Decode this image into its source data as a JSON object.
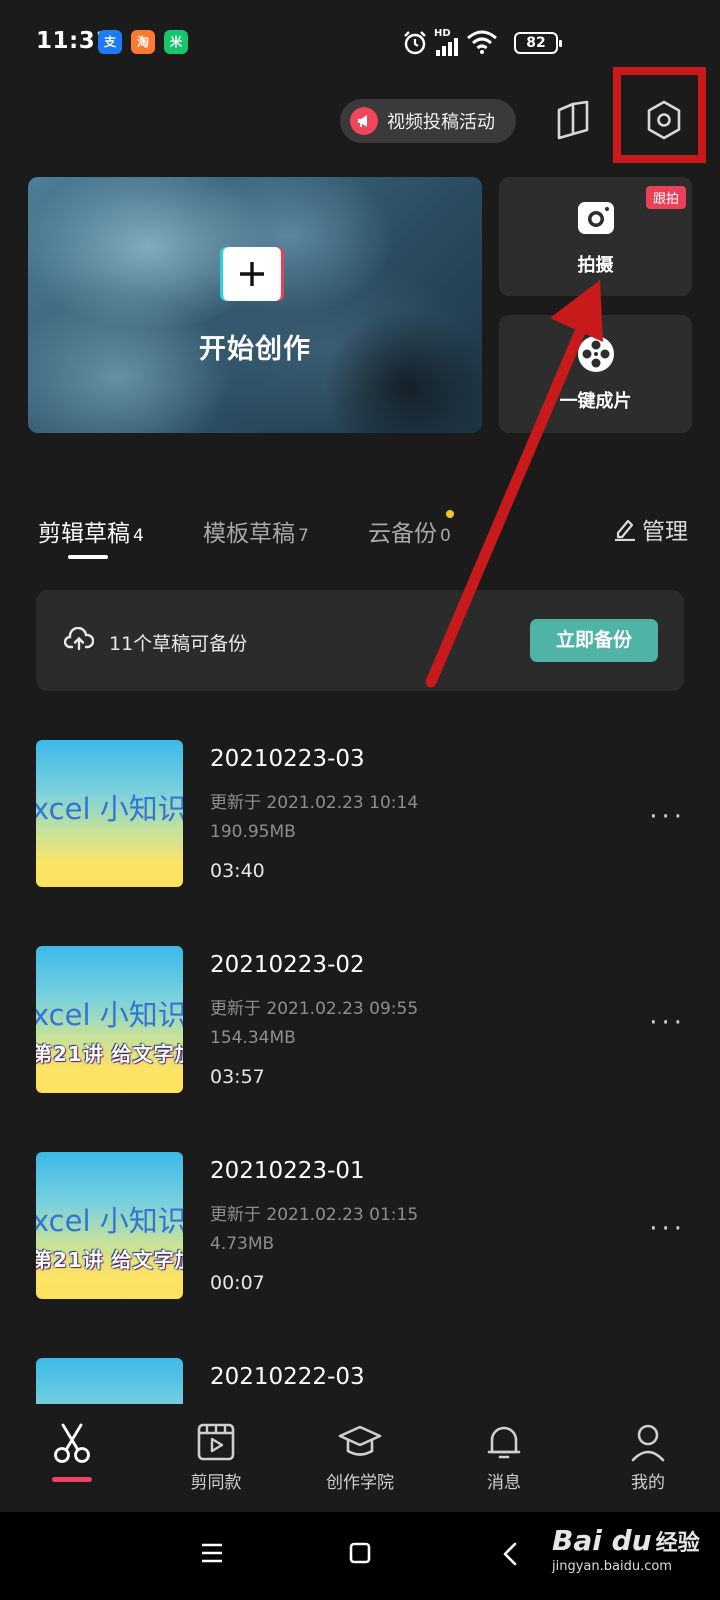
{
  "status_bar": {
    "time": "11:31",
    "battery": "82",
    "network": "HD",
    "app_badges": [
      {
        "icon": "alipay-icon",
        "color": "#1f7bf2"
      },
      {
        "icon": "taobao-icon",
        "color": "#ff7a2e"
      },
      {
        "icon": "mijia-icon",
        "color": "#18c46c"
      }
    ]
  },
  "top_bar": {
    "promo_label": "视频投稿活动"
  },
  "hero": {
    "title": "开始创作"
  },
  "side_cards": {
    "shoot_label": "拍摄",
    "shoot_badge": "跟拍",
    "oneclick_label": "一键成片"
  },
  "tabs": [
    {
      "label": "剪辑草稿",
      "count": "4",
      "active": true
    },
    {
      "label": "模板草稿",
      "count": "7",
      "active": false
    },
    {
      "label": "云备份",
      "count": "0",
      "active": false
    }
  ],
  "manage_label": "管理",
  "backup_banner": {
    "text": "11个草稿可备份",
    "button": "立即备份"
  },
  "drafts": [
    {
      "title": "20210223-03",
      "updated": "更新于 2021.02.23 10:14",
      "size": "190.95MB",
      "duration": "03:40",
      "thumb_text": "xcel 小知识",
      "thumb_sub": ""
    },
    {
      "title": "20210223-02",
      "updated": "更新于 2021.02.23 09:55",
      "size": "154.34MB",
      "duration": "03:57",
      "thumb_text": "xcel 小知识",
      "thumb_sub": "第21讲 给文字加"
    },
    {
      "title": "20210223-01",
      "updated": "更新于 2021.02.23 01:15",
      "size": "4.73MB",
      "duration": "00:07",
      "thumb_text": "xcel 小知识",
      "thumb_sub": "第21讲 给文字加"
    },
    {
      "title": "20210222-03"
    }
  ],
  "bottom_nav": [
    {
      "label": "",
      "icon": "scissors-icon",
      "active": true
    },
    {
      "label": "剪同款",
      "icon": "template-film-icon",
      "active": false
    },
    {
      "label": "创作学院",
      "icon": "graduation-cap-icon",
      "active": false
    },
    {
      "label": "消息",
      "icon": "bell-icon",
      "active": false
    },
    {
      "label": "我的",
      "icon": "profile-icon",
      "active": false
    }
  ],
  "watermark": {
    "brand": "Bai du",
    "brand_cn": "经验",
    "url": "jingyan.baidu.com"
  },
  "colors": {
    "background": "#1b1b1b",
    "accent_red": "#ec4362",
    "backup_button": "#4fb3a6",
    "annotation_red": "#c81a1a"
  }
}
